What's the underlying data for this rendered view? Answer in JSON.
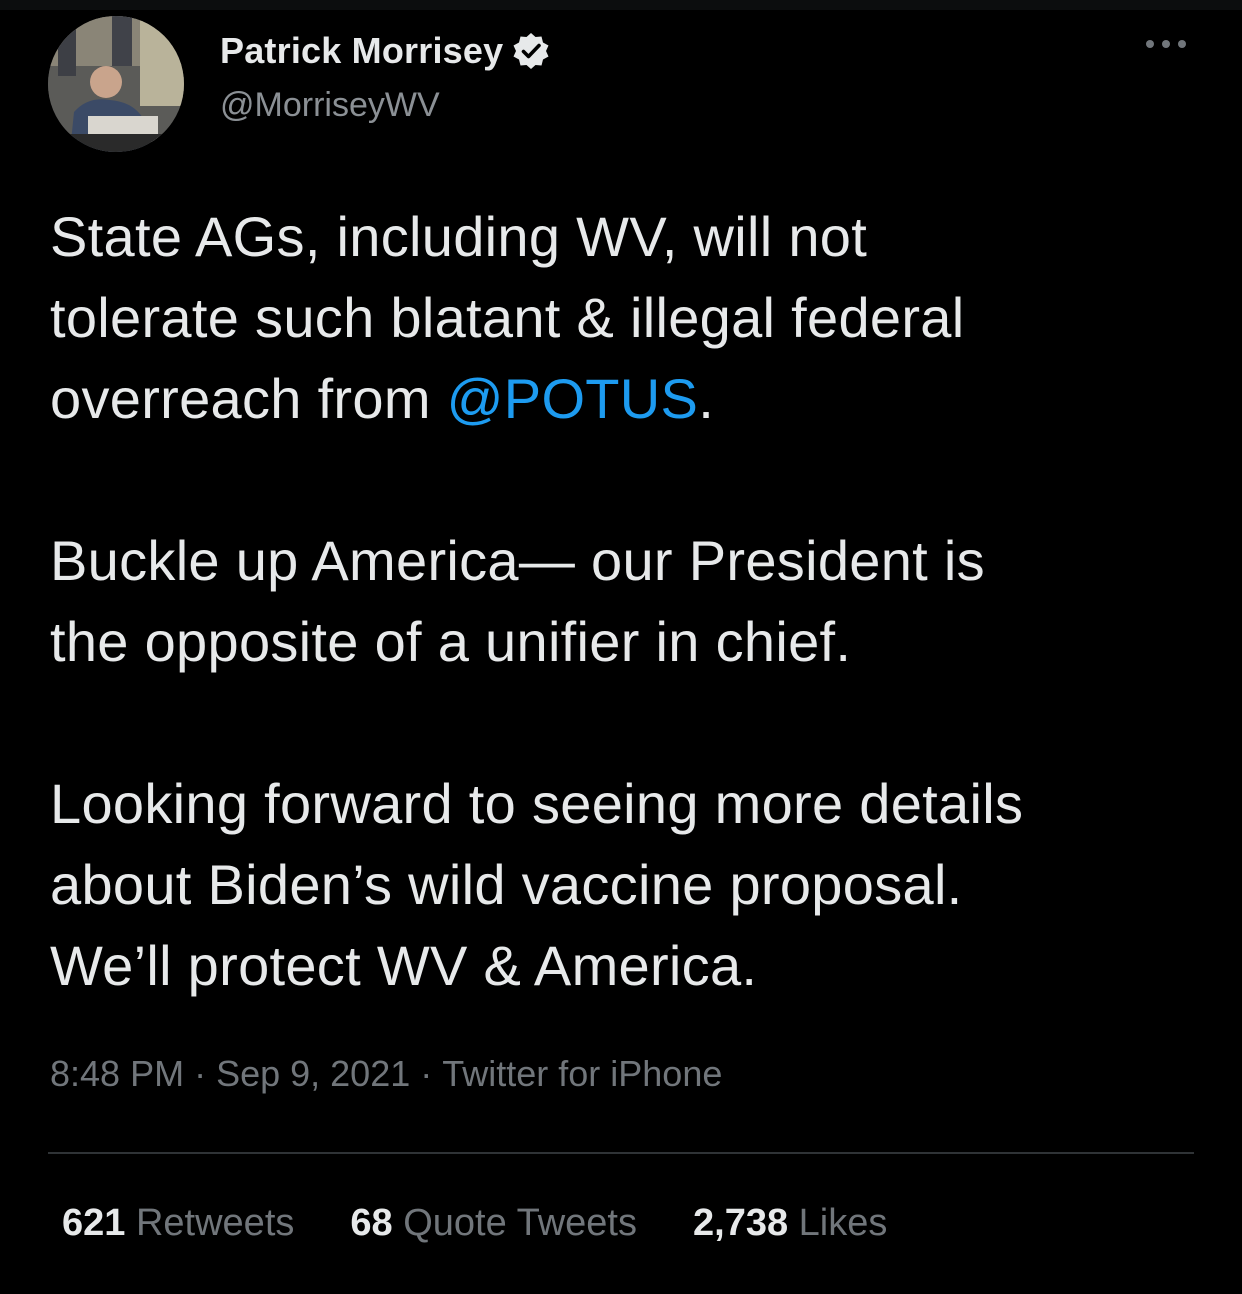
{
  "colors": {
    "background": "#000000",
    "text": "#e7e9ea",
    "secondary": "#71767b",
    "link": "#1d9bf0",
    "divider": "#2f3336"
  },
  "author": {
    "display_name": "Patrick Morrisey",
    "handle": "@MorriseyWV",
    "verified_icon": "verified-badge-icon",
    "avatar_icon": "avatar-photo"
  },
  "tweet": {
    "line1": "State AGs, including WV, will not",
    "line2": "tolerate such blatant & illegal federal",
    "line3_pre": "overreach from ",
    "mention": "@POTUS",
    "line3_post": ".",
    "line4": "Buckle up America— our President is",
    "line5": "the opposite of a unifier in chief.",
    "line6": "Looking forward to seeing more details",
    "line7": "about Biden’s wild vaccine proposal.",
    "line8": "We’ll protect WV & America."
  },
  "meta": {
    "time": "8:48 PM",
    "separator": "·",
    "date": "Sep 9, 2021",
    "source": "Twitter for iPhone"
  },
  "stats": {
    "retweets_count": "621",
    "retweets_label": "Retweets",
    "quotes_count": "68",
    "quotes_label": "Quote Tweets",
    "likes_count": "2,738",
    "likes_label": "Likes"
  }
}
